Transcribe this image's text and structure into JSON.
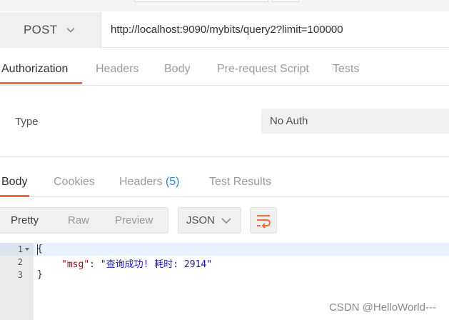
{
  "request": {
    "method": "POST",
    "url": "http://localhost:9090/mybits/query2?limit=100000"
  },
  "request_tabs": [
    {
      "label": "Authorization",
      "active": true
    },
    {
      "label": "Headers",
      "active": false
    },
    {
      "label": "Body",
      "active": false
    },
    {
      "label": "Pre-request Script",
      "active": false
    },
    {
      "label": "Tests",
      "active": false
    }
  ],
  "auth": {
    "type_label": "Type",
    "type_value": "No Auth"
  },
  "response_tabs": [
    {
      "label": "Body",
      "active": true
    },
    {
      "label": "Cookies",
      "active": false
    },
    {
      "label": "Headers",
      "count": "(5)",
      "active": false
    },
    {
      "label": "Test Results",
      "active": false
    }
  ],
  "view_modes": [
    {
      "label": "Pretty",
      "active": true
    },
    {
      "label": "Raw",
      "active": false
    },
    {
      "label": "Preview",
      "active": false
    }
  ],
  "format": "JSON",
  "response_body": {
    "line_numbers": [
      "1",
      "2",
      "3"
    ],
    "line1": "{",
    "line2_key": "\"msg\"",
    "line2_sep": ": ",
    "line2_value": "\"查询成功! 耗时: 2914\"",
    "line3": "}"
  },
  "watermark": "CSDN @HelloWorld---",
  "colors": {
    "accent": "#f26b3a",
    "count": "#2f87cf",
    "json_key": "#a01010",
    "json_string": "#1a1aa6"
  }
}
